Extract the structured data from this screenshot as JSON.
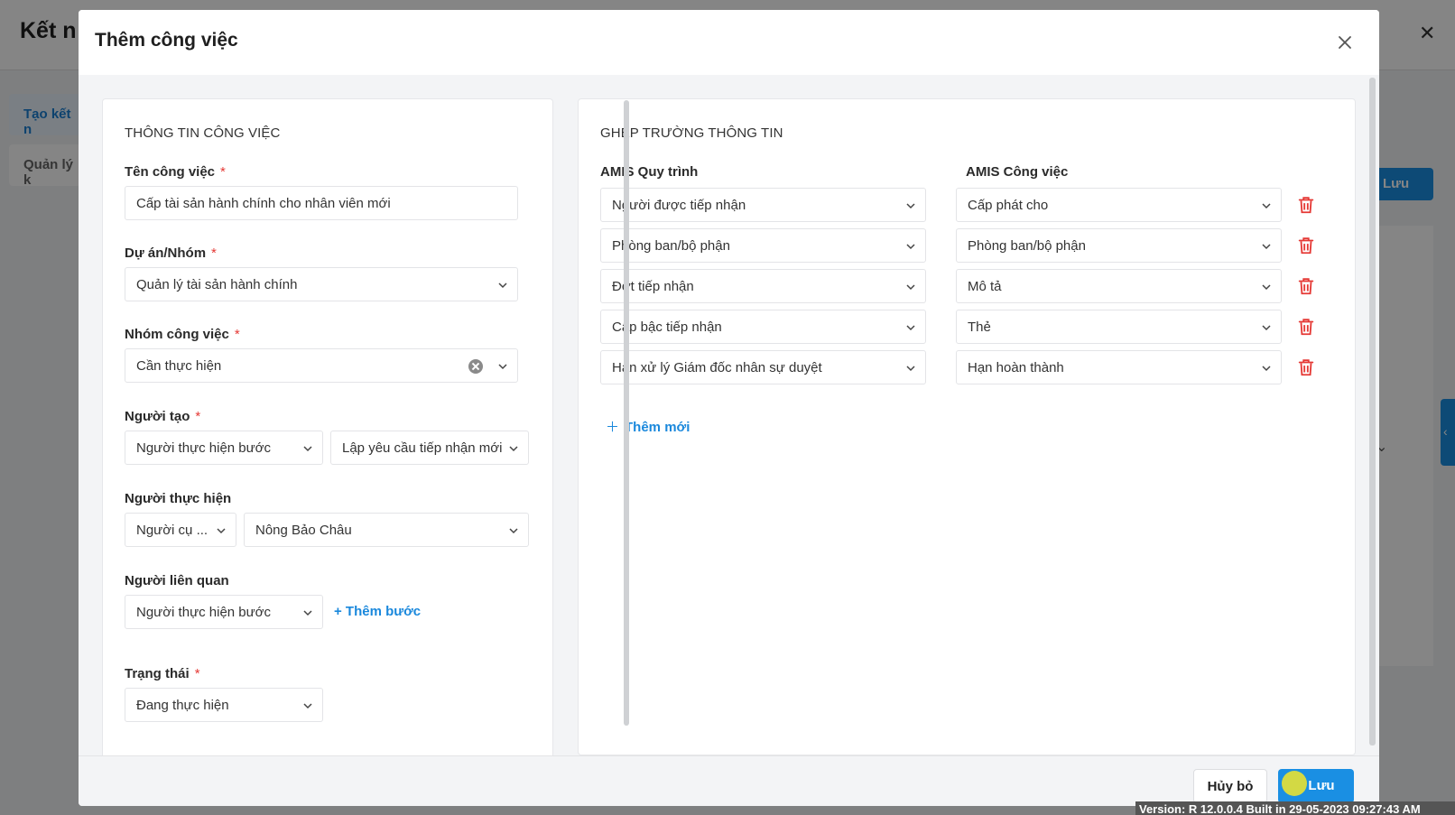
{
  "background": {
    "title": "Kết n",
    "sidebar": [
      "Tạo kết n",
      "Quản lý k"
    ],
    "save_label": "Lưu"
  },
  "modal": {
    "title": "Thêm công việc",
    "left": {
      "section_title": "THÔNG TIN CÔNG VIỆC",
      "task_name": {
        "label": "Tên công việc",
        "value": "Cấp tài sản hành chính cho nhân viên mới"
      },
      "project": {
        "label": "Dự án/Nhóm",
        "value": "Quản lý tài sản hành chính"
      },
      "task_group": {
        "label": "Nhóm công việc",
        "value": "Cần thực hiện"
      },
      "creator": {
        "label": "Người tạo",
        "value1": "Người thực hiện bước",
        "value2": "Lập yêu cầu tiếp nhận mới"
      },
      "assignee": {
        "label": "Người thực hiện",
        "value1": "Người cụ ...",
        "value2": "Nông Bảo Châu"
      },
      "related": {
        "label": "Người liên quan",
        "value": "Người thực hiện bước",
        "add_step": "+ Thêm bước"
      },
      "status": {
        "label": "Trạng thái",
        "value": "Đang thực hiện"
      }
    },
    "right": {
      "section_title": "GHÉP TRƯỜNG THÔNG TIN",
      "col_left": "AMIS Quy trình",
      "col_right": "AMIS Công việc",
      "rows": [
        {
          "source": "Người được tiếp nhận",
          "target": "Cấp phát cho"
        },
        {
          "source": "Phòng ban/bộ phận",
          "target": "Phòng ban/bộ phận"
        },
        {
          "source": "Đợt tiếp nhận",
          "target": "Mô tả"
        },
        {
          "source": "Cấp bậc tiếp nhận",
          "target": "Thẻ"
        },
        {
          "source": "Hạn xử lý Giám đốc nhân sự duyệt",
          "target": "Hạn hoàn thành"
        }
      ],
      "add_new": "Thêm mới"
    },
    "footer": {
      "cancel": "Hủy bỏ",
      "save": "Lưu"
    },
    "required_mark": "*"
  },
  "version": "Version: R 12.0.0.4 Built in 29-05-2023 09:27:43 AM",
  "colors": {
    "accent": "#1a8fe3",
    "danger": "#e53935",
    "link": "#1a88dc"
  },
  "icons": {
    "close": "close-icon",
    "chevron": "chevron-down-icon",
    "trash": "trash-icon",
    "clear": "clear-circle-icon"
  }
}
